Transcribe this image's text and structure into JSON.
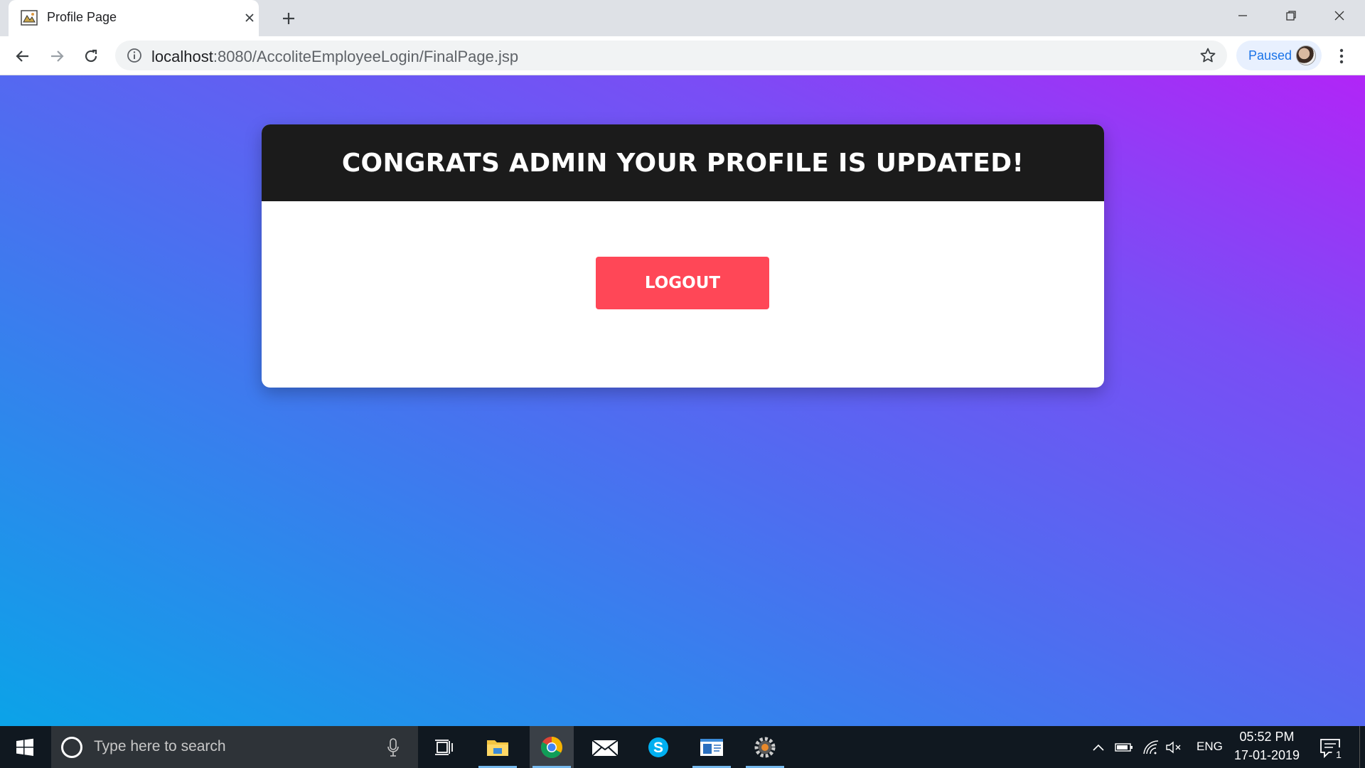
{
  "browser": {
    "tab_title": "Profile Page",
    "url_host": "localhost",
    "url_path": ":8080/AccoliteEmployeeLogin/FinalPage.jsp",
    "profile_status": "Paused"
  },
  "page": {
    "heading": "CONGRATS ADMIN YOUR PROFILE IS UPDATED!",
    "logout_label": "LOGOUT",
    "colors": {
      "header_bg": "#1b1b1b",
      "logout_bg": "#ff4757",
      "gradient_start": "#0ba3e8",
      "gradient_end": "#b125f7"
    }
  },
  "taskbar": {
    "search_placeholder": "Type here to search",
    "apps": [
      "task-view-icon",
      "file-explorer-icon",
      "chrome-icon",
      "mail-icon",
      "skype-icon",
      "notepad-icon",
      "settings-gear-icon"
    ],
    "language": "ENG",
    "time": "05:52 PM",
    "date": "17-01-2019",
    "notification_count": "1"
  }
}
